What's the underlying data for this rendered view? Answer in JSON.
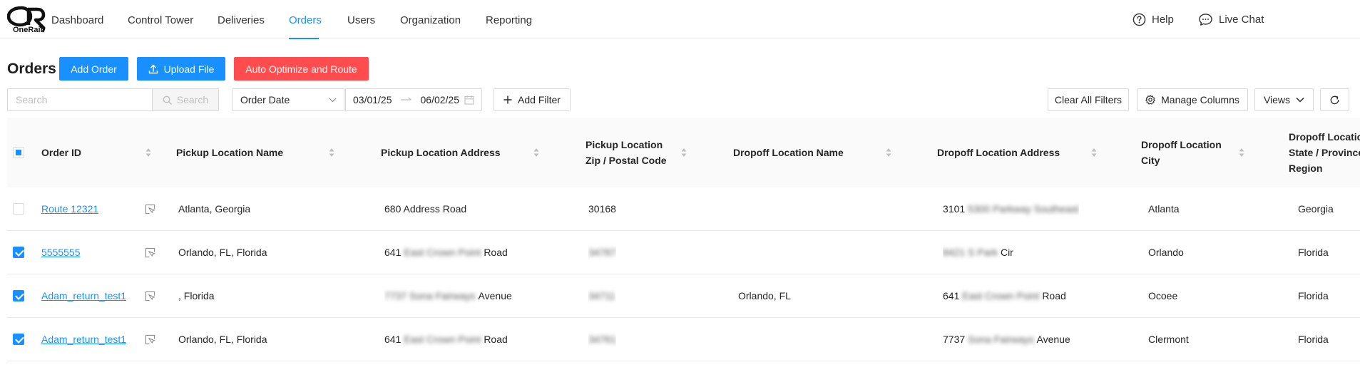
{
  "app": {
    "logo_text": "OneRail"
  },
  "nav": {
    "items": [
      {
        "label": "Dashboard",
        "active": false
      },
      {
        "label": "Control Tower",
        "active": false
      },
      {
        "label": "Deliveries",
        "active": false
      },
      {
        "label": "Orders",
        "active": true
      },
      {
        "label": "Users",
        "active": false
      },
      {
        "label": "Organization",
        "active": false
      },
      {
        "label": "Reporting",
        "active": false
      }
    ],
    "help_label": "Help",
    "live_chat_label": "Live Chat"
  },
  "page": {
    "title": "Orders",
    "add_order_label": "Add Order",
    "upload_file_label": "Upload File",
    "auto_optimize_label": "Auto Optimize and Route"
  },
  "filters": {
    "search_placeholder": "Search",
    "search_button_label": "Search",
    "date_field_value": "Order Date",
    "date_start": "03/01/25",
    "date_end": "06/02/25",
    "add_filter_label": "Add Filter",
    "clear_all_label": "Clear All Filters",
    "manage_columns_label": "Manage Columns",
    "views_label": "Views"
  },
  "table": {
    "columns": [
      "Order ID",
      "Pickup Location Name",
      "Pickup Location Address",
      "Pickup Location Zip / Postal Code",
      "Dropoff Location Name",
      "Dropoff Location Address",
      "Dropoff Location City",
      "Dropoff Location State / Province / Region"
    ],
    "column_lines": {
      "zip": [
        "Pickup Location",
        "Zip / Postal Code"
      ],
      "city": [
        "Dropoff Location",
        "City"
      ],
      "state": [
        "Dropoff Location",
        "State / Province /",
        "Region"
      ]
    },
    "header_checkbox": "indeterminate",
    "rows": [
      {
        "checked": false,
        "order_id": "Route 12321",
        "pickup_name": "Atlanta, Georgia",
        "pickup_address_visible": "680 Address Road",
        "pickup_address_blurred": "",
        "pickup_zip": "30168",
        "zip_blurred": false,
        "dropoff_name": "",
        "dropoff_address_prefix": "3101",
        "dropoff_address_blurred": "5300 Parkway Southeast",
        "dropoff_address_suffix": "",
        "city": "Atlanta",
        "state": "Georgia"
      },
      {
        "checked": true,
        "order_id": "5555555",
        "pickup_name": "Orlando, FL, Florida",
        "pickup_address_prefix": "641",
        "pickup_address_blurred": "East Crown Point",
        "pickup_address_suffix": "Road",
        "pickup_zip": "34787",
        "zip_blurred": true,
        "dropoff_name": "",
        "dropoff_address_prefix": "",
        "dropoff_address_blurred": "8421 S Park",
        "dropoff_address_suffix": "Cir",
        "city": "Orlando",
        "state": "Florida"
      },
      {
        "checked": true,
        "order_id": "Adam_return_test1",
        "pickup_name": ", Florida",
        "pickup_address_prefix": "",
        "pickup_address_blurred": "7737 Sona Fairways",
        "pickup_address_suffix": "Avenue",
        "pickup_zip": "34711",
        "zip_blurred": true,
        "dropoff_name": "Orlando, FL",
        "dropoff_address_prefix": "641",
        "dropoff_address_blurred": "East Crown Point",
        "dropoff_address_suffix": "Road",
        "city": "Ocoee",
        "state": "Florida"
      },
      {
        "checked": true,
        "order_id": "Adam_return_test1",
        "pickup_name": "Orlando, FL, Florida",
        "pickup_address_prefix": "641",
        "pickup_address_blurred": "East Crown Point",
        "pickup_address_suffix": "Road",
        "pickup_zip": "34761",
        "zip_blurred": true,
        "dropoff_name": "",
        "dropoff_address_prefix": "7737",
        "dropoff_address_blurred": "Sona Fairways",
        "dropoff_address_suffix": "Avenue",
        "city": "Clermont",
        "state": "Florida"
      }
    ]
  },
  "colors": {
    "accent": "#1890ff",
    "danger": "#ff4d4f",
    "header_bg": "#fafafa",
    "border": "#d9d9d9"
  },
  "icons": [
    "onerail-logo",
    "help-icon",
    "live-chat-icon",
    "upload-icon",
    "search-icon",
    "chevron-down-icon",
    "swap-right-icon",
    "calendar-icon",
    "plus-icon",
    "gear-icon",
    "refresh-icon",
    "sort-icon",
    "open-detail-icon"
  ]
}
